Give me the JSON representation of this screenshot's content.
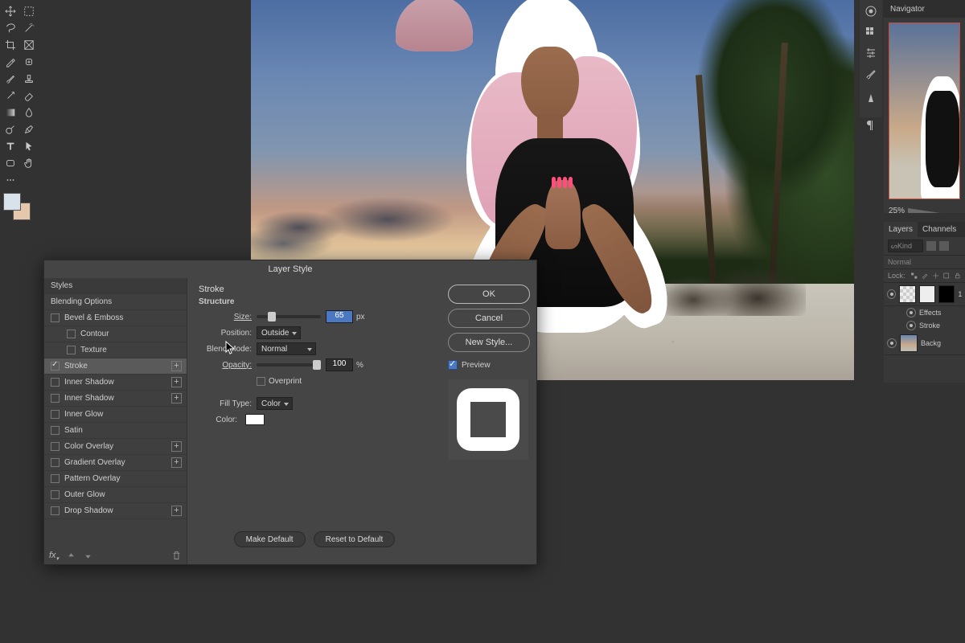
{
  "canvas": {},
  "toolbox": {},
  "dialog": {
    "title": "Layer Style",
    "styles_header": "Styles",
    "blending_options": "Blending Options",
    "effects": {
      "bevel_emboss": "Bevel & Emboss",
      "contour": "Contour",
      "texture": "Texture",
      "stroke": "Stroke",
      "inner_shadow": "Inner Shadow",
      "inner_shadow2": "Inner Shadow",
      "inner_glow": "Inner Glow",
      "satin": "Satin",
      "color_overlay": "Color Overlay",
      "gradient_overlay": "Gradient Overlay",
      "pattern_overlay": "Pattern Overlay",
      "outer_glow": "Outer Glow",
      "drop_shadow": "Drop Shadow"
    },
    "stroke": {
      "heading": "Stroke",
      "structure": "Structure",
      "size_label": "Size:",
      "size_value": "65",
      "size_unit": "px",
      "position_label": "Position:",
      "position_value": "Outside",
      "blend_label": "Blend Mode:",
      "blend_value": "Normal",
      "opacity_label": "Opacity:",
      "opacity_value": "100",
      "opacity_unit": "%",
      "overprint": "Overprint",
      "fill_type_label": "Fill Type:",
      "fill_type_value": "Color",
      "color_label": "Color:",
      "make_default": "Make Default",
      "reset_default": "Reset to Default"
    },
    "buttons": {
      "ok": "OK",
      "cancel": "Cancel",
      "new_style": "New Style...",
      "preview": "Preview"
    }
  },
  "navigator": {
    "tab": "Navigator",
    "zoom": "25%"
  },
  "layers": {
    "tab_layers": "Layers",
    "tab_channels": "Channels",
    "kind_label": "Kind",
    "blend_mode": "Normal",
    "lock_label": "Lock:",
    "layer1": {
      "name": "1"
    },
    "effects_label": "Effects",
    "stroke_label": "Stroke",
    "bg_name": "Backg"
  }
}
